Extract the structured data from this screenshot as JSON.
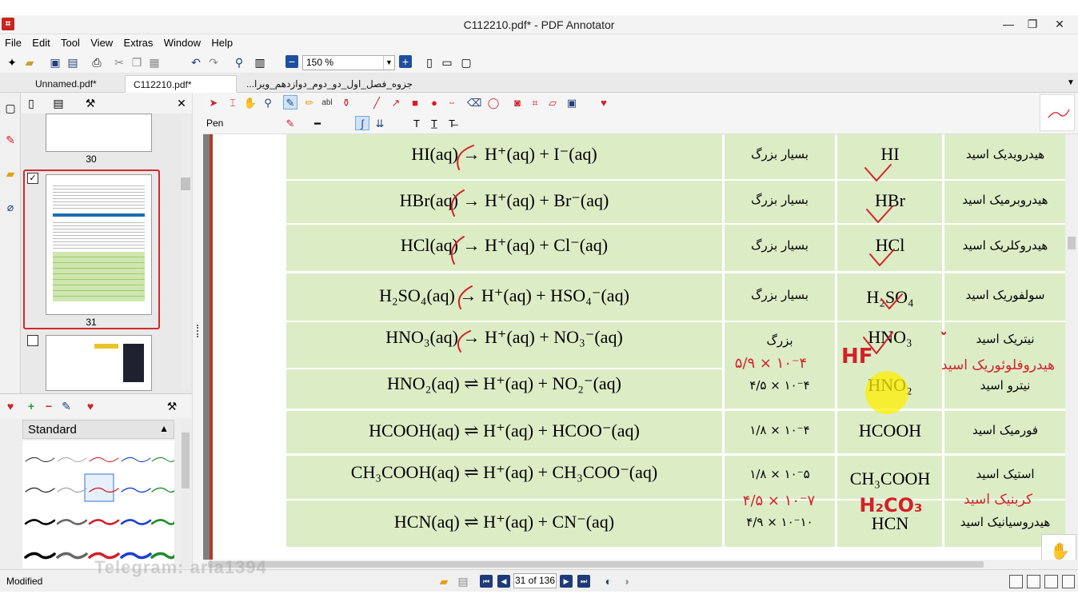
{
  "window": {
    "title": "C112210.pdf* - PDF Annotator",
    "minimize": "—",
    "restore": "❐",
    "close": "✕"
  },
  "menu": [
    "File",
    "Edit",
    "Tool",
    "View",
    "Extras",
    "Window",
    "Help"
  ],
  "toolbar": {
    "zoom_value": "150 %"
  },
  "tabs": [
    {
      "label": "Unnamed.pdf*"
    },
    {
      "label": "C112210.pdf*"
    },
    {
      "label": "جزوه_فصل_اول_دو_دوم_دوازدهم_ویرا..."
    }
  ],
  "thumbnails": [
    {
      "page": "30"
    },
    {
      "page": "31"
    }
  ],
  "pen_panel": {
    "header": "Standard"
  },
  "annot_toolbar": {
    "mode_label": "Pen"
  },
  "acid_table": {
    "rows": [
      {
        "equation": "HI(aq) → H⁺(aq) + I⁻(aq)",
        "ka": "بسیار بزرگ",
        "formula": "HI",
        "name": "هیدرویدیک اسید"
      },
      {
        "equation": "HBr(aq) → H⁺(aq) + Br⁻(aq)",
        "ka": "بسیار بزرگ",
        "formula": "HBr",
        "name": "هیدروبرمیک اسید"
      },
      {
        "equation": "HCl(aq) → H⁺(aq) + Cl⁻(aq)",
        "ka": "بسیار بزرگ",
        "formula": "HCl",
        "name": "هیدروکلریک اسید"
      },
      {
        "equation": "H₂SO₄(aq) → H⁺(aq) + HSO₄⁻(aq)",
        "ka": "بسیار بزرگ",
        "formula": "H₂SO₄",
        "name": "سولفوریک اسید"
      },
      {
        "equation": "HNO₃(aq) → H⁺(aq) + NO₃⁻(aq)",
        "ka": "بزرگ",
        "formula": "HNO₃",
        "name": "نیتریک اسید"
      },
      {
        "equation": "HNO₂(aq) ⇌ H⁺(aq) + NO₂⁻(aq)",
        "ka": "۴/۵ × ۱۰⁻۴",
        "formula": "HNO₂",
        "name": "نیترو اسید"
      },
      {
        "equation": "HCOOH(aq) ⇌ H⁺(aq) + HCOO⁻(aq)",
        "ka": "۱/۸ × ۱۰⁻۴",
        "formula": "HCOOH",
        "name": "فورمیک اسید"
      },
      {
        "equation": "CH₃COOH(aq) ⇌ H⁺(aq) + CH₃COO⁻(aq)",
        "ka": "۱/۸ × ۱۰⁻۵",
        "formula": "CH₃COOH",
        "name": "استیک اسید"
      },
      {
        "equation": "HCN(aq) ⇌ H⁺(aq) + CN⁻(aq)",
        "ka": "۴/۹ × ۱۰⁻۱۰",
        "formula": "HCN",
        "name": "هیدروسیانیک اسید"
      }
    ]
  },
  "handwritten": {
    "hf_ka": "۵/۹ × ۱۰⁻۴",
    "hf_formula": "HF",
    "hf_name": "هیدروفلوئوریک اسید",
    "h2co3_ka": "۴/۵ × ۱۰⁻۷",
    "h2co3_formula": "H₂CO₃",
    "h2co3_name": "کربنیک اسید"
  },
  "status": {
    "left": "Modified",
    "page_indicator": "31 of 136",
    "watermark": "Telegram: aria1394"
  },
  "colors": {
    "table_green": "#dcedc6",
    "annotation_red": "#d4202a",
    "highlight_yellow": "#ffee00",
    "selected_thumb_border": "#d22a2a",
    "page_left_bar": "#b23a2a"
  }
}
